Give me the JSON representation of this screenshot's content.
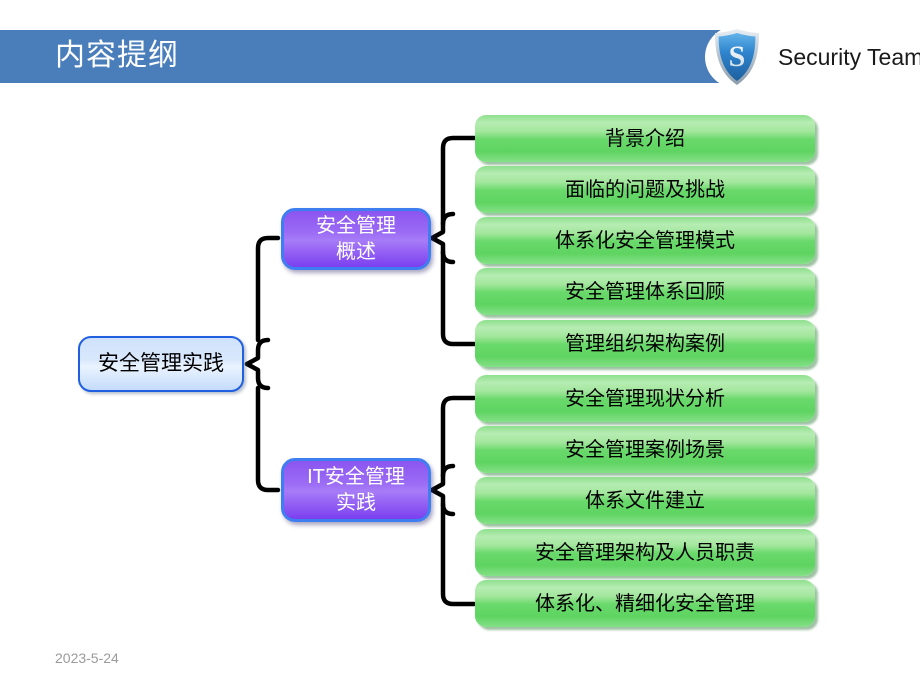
{
  "slide": {
    "title": "内容提纲",
    "date": "2023-5-24",
    "brand": {
      "name": "Security Team",
      "logo_icon": "shield-s-icon",
      "bar_color": "#4a7ebb"
    }
  },
  "diagram": {
    "type": "mind-map",
    "root": {
      "label": "安全管理实践",
      "fill": "#d5e6fb",
      "border": "#1f5fe0",
      "text_color": "#000000"
    },
    "branches": [
      {
        "label": "安全管理\n概述",
        "fill": "#9b6bf5",
        "border": "#3f7ef0",
        "text_color": "#ffffff",
        "leaves": [
          {
            "label": "背景介绍"
          },
          {
            "label": "面临的问题及挑战"
          },
          {
            "label": "体系化安全管理模式"
          },
          {
            "label": "安全管理体系回顾"
          },
          {
            "label": "管理组织架构案例"
          }
        ]
      },
      {
        "label": "IT安全管理\n实践",
        "fill": "#9b6bf5",
        "border": "#3f7ef0",
        "text_color": "#ffffff",
        "leaves": [
          {
            "label": "安全管理现状分析"
          },
          {
            "label": "安全管理案例场景"
          },
          {
            "label": "体系文件建立"
          },
          {
            "label": "安全管理架构及人员职责"
          },
          {
            "label": "体系化、精细化安全管理"
          }
        ]
      }
    ],
    "leaf_fill": "#69d96b",
    "connector_color": "#000000"
  }
}
